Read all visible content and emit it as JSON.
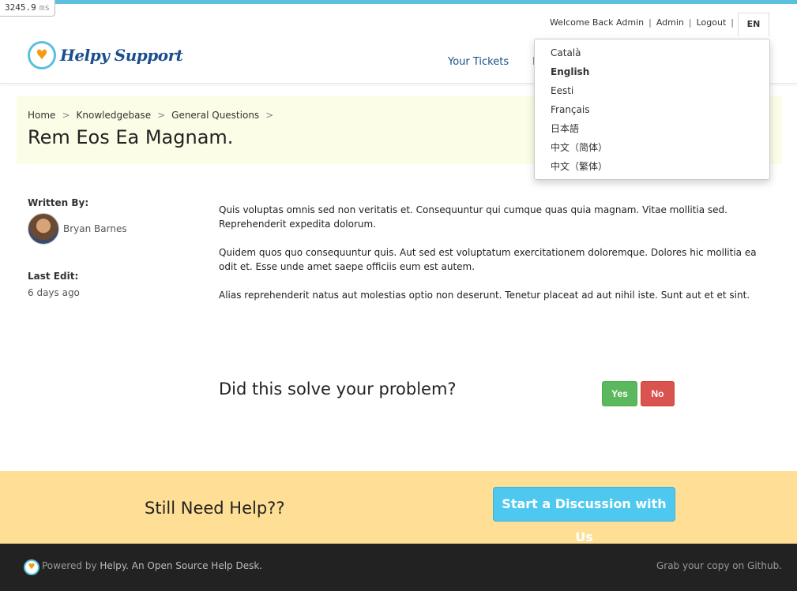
{
  "timing": {
    "value": "3245.9",
    "unit": "ms"
  },
  "header": {
    "welcome": "Welcome Back Admin",
    "admin_link": "Admin",
    "logout_link": "Logout",
    "separator": "|",
    "lang_code": "EN",
    "logo_text": "Helpy Support",
    "nav": {
      "your_tickets": "Your Tickets",
      "knowledgebase_partial": "K"
    }
  },
  "language_menu": {
    "items": [
      "Català",
      "English",
      "Eesti",
      "Français",
      "日本語",
      "中文（简体）",
      "中文（繁体）"
    ],
    "selected": "English"
  },
  "breadcrumb": {
    "items": [
      "Home",
      "Knowledgebase",
      "General Questions"
    ],
    "separator": ">"
  },
  "article": {
    "title": "Rem Eos Ea Magnam.",
    "written_by_label": "Written By:",
    "author": "Bryan Barnes",
    "last_edit_label": "Last Edit:",
    "last_edit_value": "6 days ago",
    "paragraphs": [
      "Quis voluptas omnis sed non veritatis et. Consequuntur qui cumque quas quia magnam. Vitae mollitia sed. Reprehenderit expedita dolorum.",
      "Quidem quos quo consequuntur quis. Aut sed est voluptatum exercitationem doloremque. Dolores hic mollitia ea odit et. Esse unde amet saepe officiis eum est autem.",
      "Alias reprehenderit natus aut molestias optio non deserunt. Tenetur placeat ad aut nihil iste. Sunt aut et et sint."
    ]
  },
  "feedback": {
    "question": "Did this solve your problem?",
    "yes": "Yes",
    "no": "No"
  },
  "help": {
    "title": "Still Need Help??",
    "button": "Start a Discussion with Us"
  },
  "footer": {
    "powered_prefix": "Powered by",
    "powered_brand": "Helpy. An Open Source Help Desk.",
    "grab": "Grab your copy on Github."
  },
  "colors": {
    "accent": "#5bc0de",
    "brand": "#1a4f8c",
    "yes": "#5cb85c",
    "no": "#d9534f",
    "help_band": "#fedf95",
    "footer": "#222222"
  },
  "icons": {
    "logo": "heart-icon",
    "author": "avatar"
  }
}
